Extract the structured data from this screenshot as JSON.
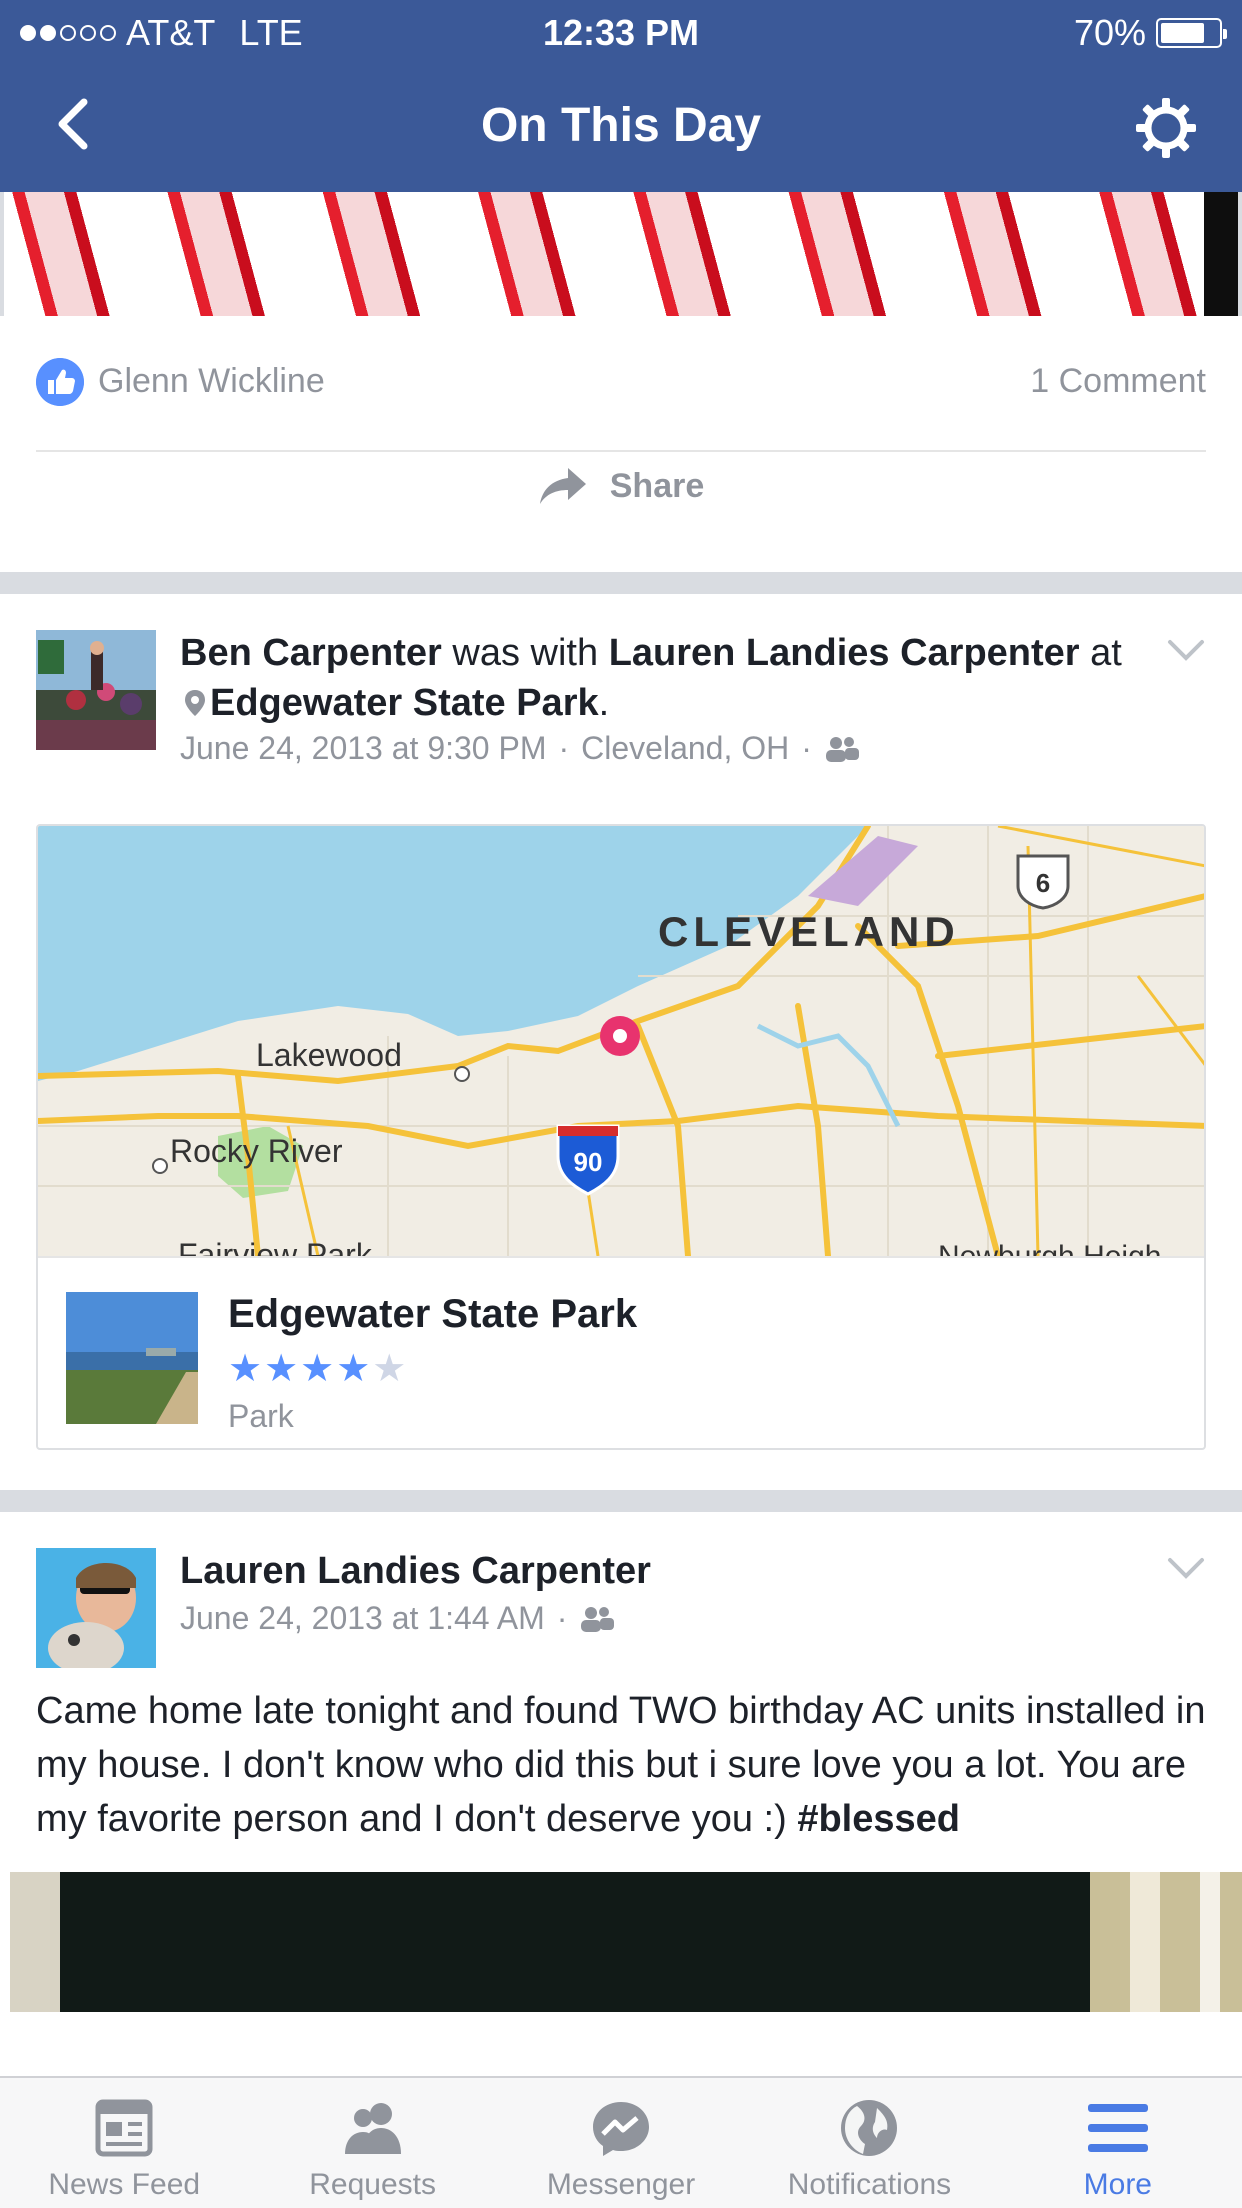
{
  "status_bar": {
    "carrier": "AT&T",
    "network": "LTE",
    "time": "12:33 PM",
    "battery": "70%",
    "battery_level": 0.7,
    "signal_bars": 2
  },
  "nav": {
    "title": "On This Day"
  },
  "first_post": {
    "liker": "Glenn Wickline",
    "comments": "1 Comment",
    "share_label": "Share"
  },
  "post2": {
    "author": "Ben Carpenter",
    "with_text": "was with",
    "tagged": "Lauren Landies Carpenter",
    "at_text": "at",
    "place": "Edgewater State Park",
    "date": "June 24, 2013 at 9:30 PM",
    "location": "Cleveland, OH",
    "map": {
      "city": "CLEVELAND",
      "labels": [
        "Lakewood",
        "Rocky River",
        "Fairview Park",
        "Newburgh Heigh"
      ],
      "highway_interstate": "90",
      "highway_us": "6"
    },
    "place_card": {
      "name": "Edgewater State Park",
      "rating": 4.5,
      "type": "Park"
    }
  },
  "post3": {
    "author": "Lauren Landies Carpenter",
    "date": "June 24, 2013 at 1:44 AM",
    "text": "Came home late tonight and found TWO birthday AC units installed in my house. I don't know who did this but i sure love you a lot. You are my favorite person and I don't deserve you :)",
    "hashtag": "#blessed"
  },
  "tabs": [
    {
      "label": "News Feed",
      "icon": "news-feed-icon"
    },
    {
      "label": "Requests",
      "icon": "requests-icon"
    },
    {
      "label": "Messenger",
      "icon": "messenger-icon"
    },
    {
      "label": "Notifications",
      "icon": "globe-icon"
    },
    {
      "label": "More",
      "icon": "menu-icon",
      "active": true
    }
  ],
  "colors": {
    "brand": "#3b5998",
    "accent": "#5890ff",
    "active_tab": "#4a7be4",
    "muted": "#90949c"
  }
}
